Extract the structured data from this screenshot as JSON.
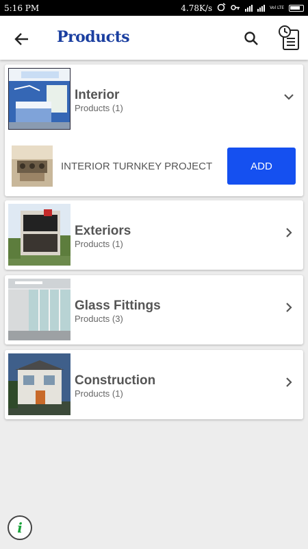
{
  "status_bar": {
    "time": "5:16 PM",
    "speed": "4.78K/s",
    "network": "Vol LTE"
  },
  "header": {
    "title": "Products",
    "back_icon": "arrow-left-icon",
    "search_icon": "search-icon",
    "history_icon": "clock-document-icon",
    "title_color": "#1b3fa0"
  },
  "categories": [
    {
      "name": "Interior",
      "count": "Products (1)",
      "expanded": true
    },
    {
      "name": "Exteriors",
      "count": "Products (1)",
      "expanded": false
    },
    {
      "name": "Glass Fittings",
      "count": "Products (3)",
      "expanded": false
    },
    {
      "name": "Construction",
      "count": "Products (1)",
      "expanded": false
    }
  ],
  "expanded_product": {
    "name": "INTERIOR TURNKEY PROJECT",
    "add_label": "ADD",
    "button_color": "#1550f0"
  },
  "info_button": {
    "label": "i",
    "icon": "info-icon"
  }
}
